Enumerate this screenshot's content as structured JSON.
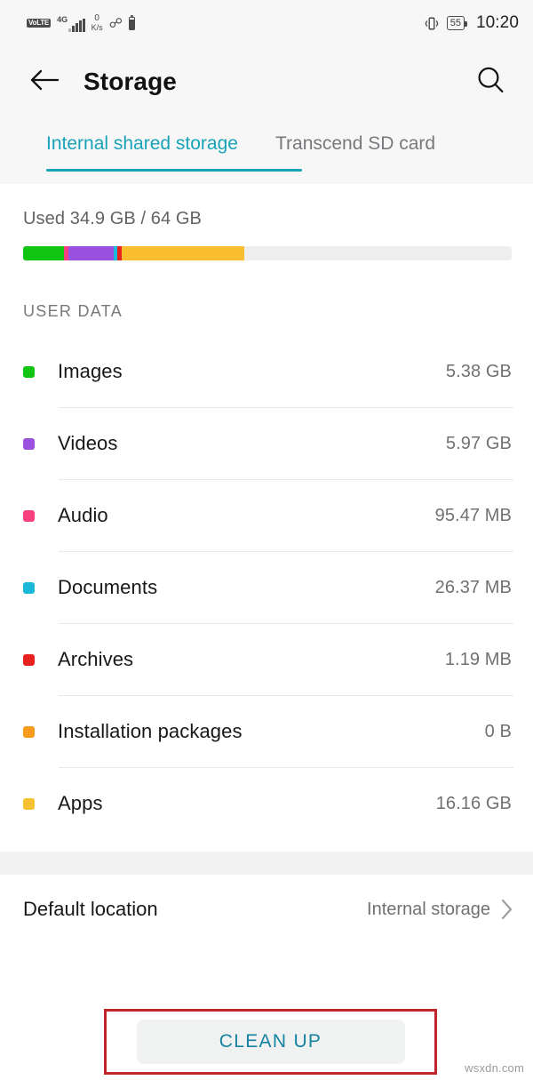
{
  "status_bar": {
    "volte_label": "VoLTE",
    "network_type": "4G",
    "signal_icon": "signal-bars-icon",
    "data_rate_value": "0",
    "data_rate_unit": "K/s",
    "bluetooth_icon": "bluetooth-icon",
    "battery_small_icon": "battery-icon",
    "vibrate_icon": "vibrate-icon",
    "battery_percent": "55",
    "time": "10:20"
  },
  "appbar": {
    "back_icon": "back-arrow-icon",
    "title": "Storage",
    "search_icon": "search-icon"
  },
  "tabs": [
    {
      "label": "Internal shared storage",
      "active": true
    },
    {
      "label": "Transcend SD card",
      "active": false
    }
  ],
  "usage": {
    "summary": "Used 34.9 GB / 64 GB",
    "used": "34.9 GB",
    "total": "64 GB",
    "segments": [
      {
        "name": "Images",
        "color": "#13c513",
        "percent": 8.4
      },
      {
        "name": "Audio",
        "color": "#f8407f",
        "percent": 0.8
      },
      {
        "name": "Videos",
        "color": "#9b51e0",
        "percent": 9.3
      },
      {
        "name": "Documents",
        "color": "#1cb8d9",
        "percent": 0.7
      },
      {
        "name": "Archives",
        "color": "#e8211f",
        "percent": 0.9
      },
      {
        "name": "Apps",
        "color": "#fbbe2e",
        "percent": 25.2
      }
    ],
    "track_color": "#eeeeee"
  },
  "section": {
    "label": "USER DATA"
  },
  "items": [
    {
      "label": "Images",
      "value": "5.38 GB",
      "color": "#13c513"
    },
    {
      "label": "Videos",
      "value": "5.97 GB",
      "color": "#9b51e0"
    },
    {
      "label": "Audio",
      "value": "95.47 MB",
      "color": "#f8407f"
    },
    {
      "label": "Documents",
      "value": "26.37 MB",
      "color": "#1cb8d9"
    },
    {
      "label": "Archives",
      "value": "1.19 MB",
      "color": "#e8211f"
    },
    {
      "label": "Installation packages",
      "value": "0 B",
      "color": "#f79a1e"
    },
    {
      "label": "Apps",
      "value": "16.16 GB",
      "color": "#f6c12e"
    }
  ],
  "default_location": {
    "label": "Default location",
    "value": "Internal storage",
    "chevron_icon": "chevron-right-icon"
  },
  "cleanup": {
    "label": "CLEAN UP",
    "highlight_color": "#c0252b"
  },
  "watermark": "wsxdn.com",
  "colors": {
    "accent": "#18a3b8",
    "cleanup_text": "#1683a0",
    "background": "#ffffff",
    "chrome": "#f7f7f7"
  }
}
